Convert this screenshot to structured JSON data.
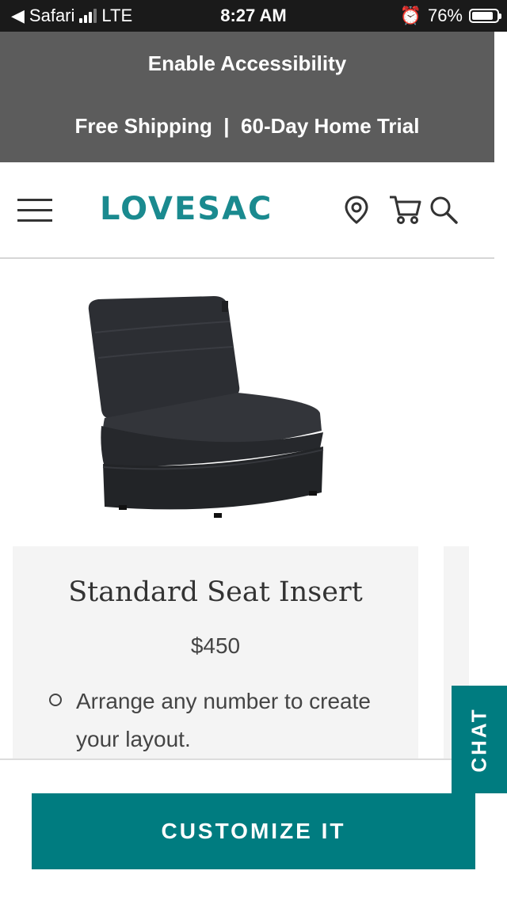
{
  "status_bar": {
    "back_app": "Safari",
    "network": "LTE",
    "time": "8:27 AM",
    "battery": "76%"
  },
  "promo": {
    "accessibility": "Enable Accessibility",
    "shipping": "Free Shipping  |  60-Day Home Trial"
  },
  "header": {
    "logo": "LOVESAC",
    "icons": [
      "menu-icon",
      "location-pin-icon",
      "cart-icon",
      "search-icon"
    ]
  },
  "product": {
    "title": "Standard Seat Insert",
    "price": "$450",
    "bullet": "Arrange any number to create your layout."
  },
  "chat": {
    "label": "CHAT"
  },
  "cta": {
    "label": "CUSTOMIZE IT"
  },
  "colors": {
    "brand_teal": "#007c80",
    "logo_teal": "#1a8a8f",
    "banner_gray": "#5c5c5c"
  }
}
